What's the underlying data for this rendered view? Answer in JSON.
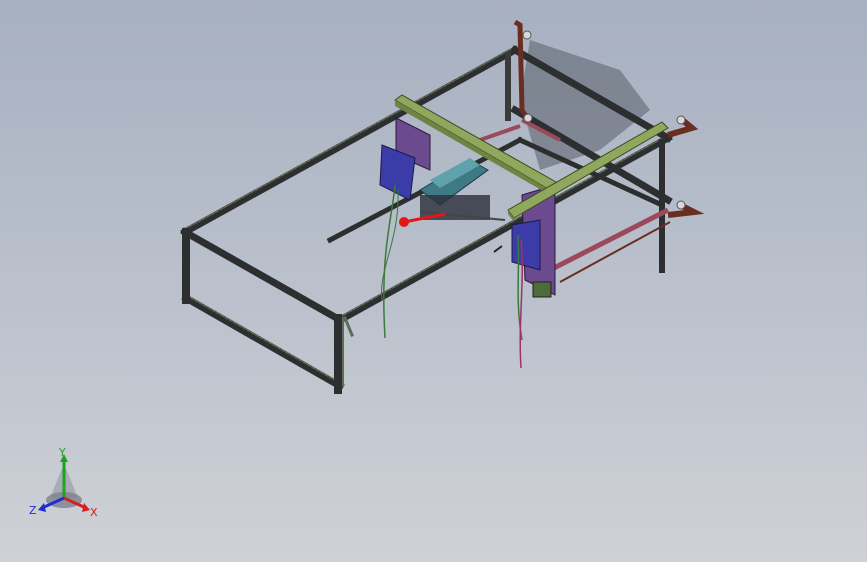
{
  "viewport": {
    "background_top": "#a7b0c1",
    "background_bottom": "#cfd1d6"
  },
  "model": {
    "frame_color": "#2c2e30",
    "frame_highlight": "#5f6b55",
    "gantry_beam_color": "#8fa85d",
    "mount_plate_color": "#6c4a8f",
    "wing_color": "#6a2e21",
    "wing_rail_color": "#9a4a5a",
    "slide_color": "#3d7a84",
    "cable_color_green": "#3a7a3a",
    "cable_color_magenta": "#a0306a",
    "marker_color": "#e01818"
  },
  "triad": {
    "x_label": "X",
    "y_label": "Y",
    "z_label": "Z",
    "x_color": "#d42020",
    "y_color": "#22a020",
    "z_color": "#2030d0"
  }
}
